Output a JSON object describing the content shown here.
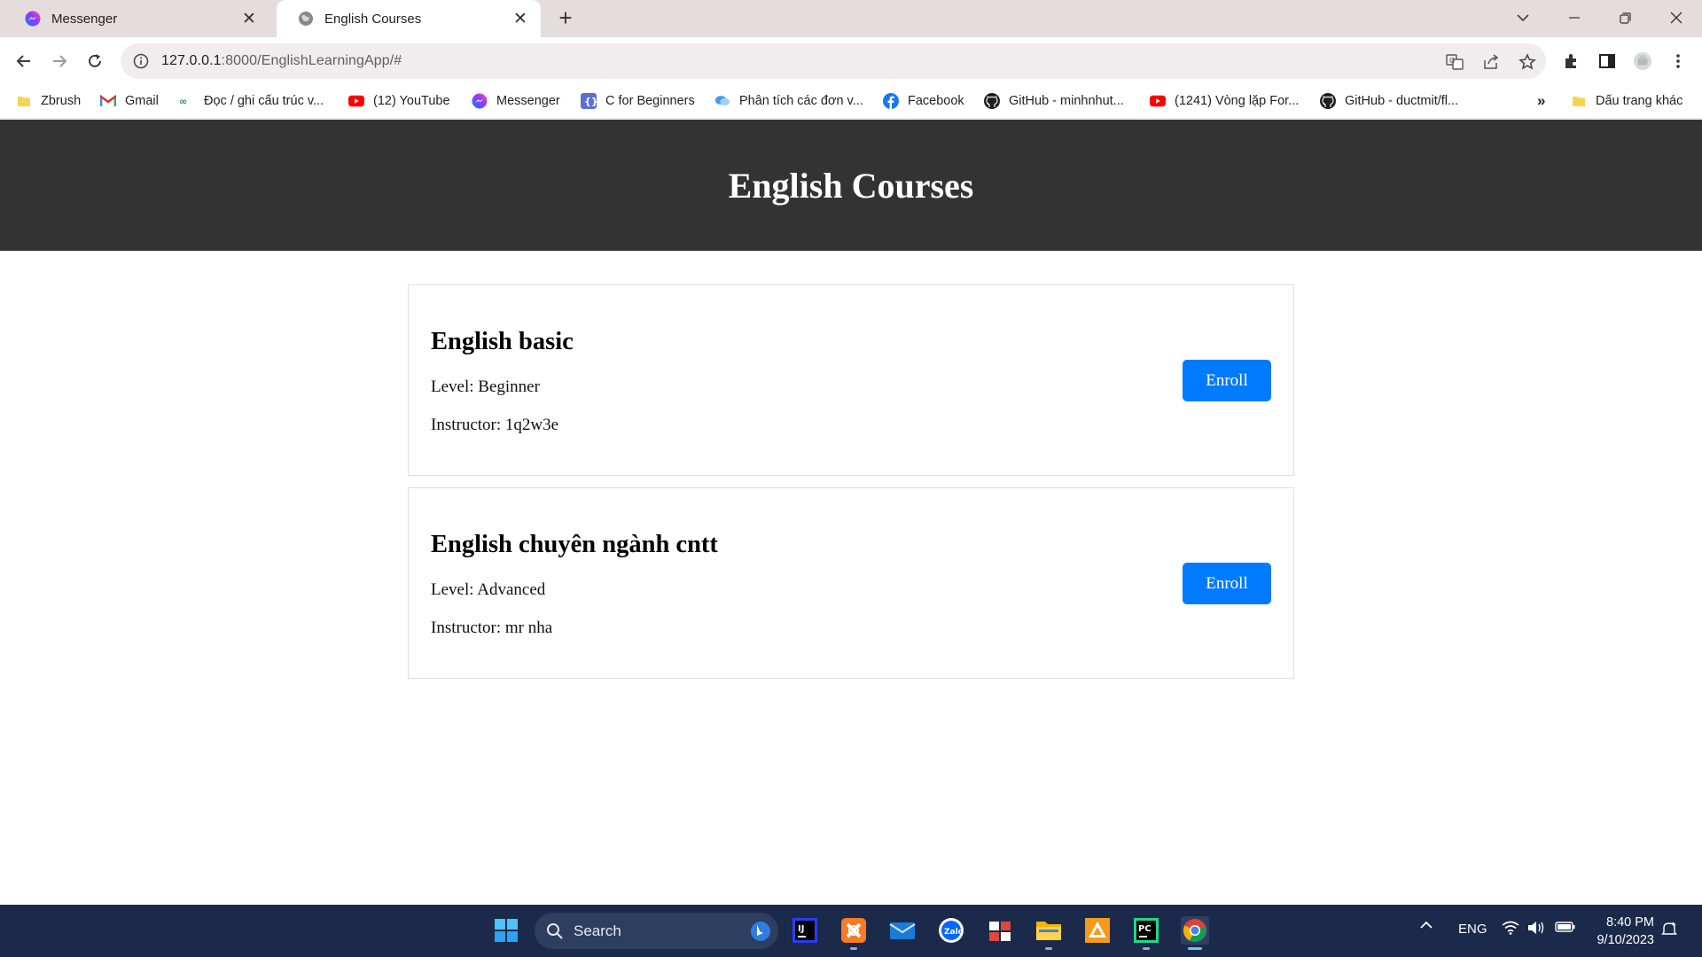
{
  "browser": {
    "tabs": [
      {
        "title": "Messenger",
        "active": false,
        "icon": "messenger-icon"
      },
      {
        "title": "English Courses",
        "active": true,
        "icon": "globe-icon"
      }
    ],
    "address": {
      "host": "127.0.0.1",
      "path": ":8000/EnglishLearningApp/#"
    },
    "bookmarks": [
      {
        "label": "Zbrush",
        "icon": "folder-icon"
      },
      {
        "label": "Gmail",
        "icon": "gmail-icon"
      },
      {
        "label": "Đọc / ghi cấu trúc v...",
        "icon": "link-icon"
      },
      {
        "label": "(12) YouTube",
        "icon": "youtube-icon"
      },
      {
        "label": "Messenger",
        "icon": "messenger-icon"
      },
      {
        "label": "C for Beginners",
        "icon": "c-icon"
      },
      {
        "label": "Phân tích các đơn v...",
        "icon": "chat-icon"
      },
      {
        "label": "Facebook",
        "icon": "facebook-icon"
      },
      {
        "label": "GitHub - minhnhut...",
        "icon": "github-icon"
      },
      {
        "label": "(1241) Vòng lặp For...",
        "icon": "youtube-icon"
      },
      {
        "label": "GitHub - ductmit/fl...",
        "icon": "github-icon"
      }
    ],
    "bookmarks_overflow": "»",
    "other_bookmarks": "Dấu trang khác"
  },
  "page": {
    "header_title": "English Courses",
    "courses": [
      {
        "name": "English basic",
        "level": "Level: Beginner",
        "instructor": "Instructor: 1q2w3e",
        "button": "Enroll"
      },
      {
        "name": "English chuyên ngành cntt",
        "level": "Level: Advanced",
        "instructor": "Instructor: mr nha",
        "button": "Enroll"
      }
    ]
  },
  "taskbar": {
    "search_label": "Search",
    "language": "ENG",
    "time": "8:40 PM",
    "date": "9/10/2023"
  },
  "colors": {
    "header_bg": "#333333",
    "enroll_bg": "#007bff",
    "taskbar_bg": "#1b2a4a",
    "tabstrip_bg": "#e4dcdd"
  }
}
